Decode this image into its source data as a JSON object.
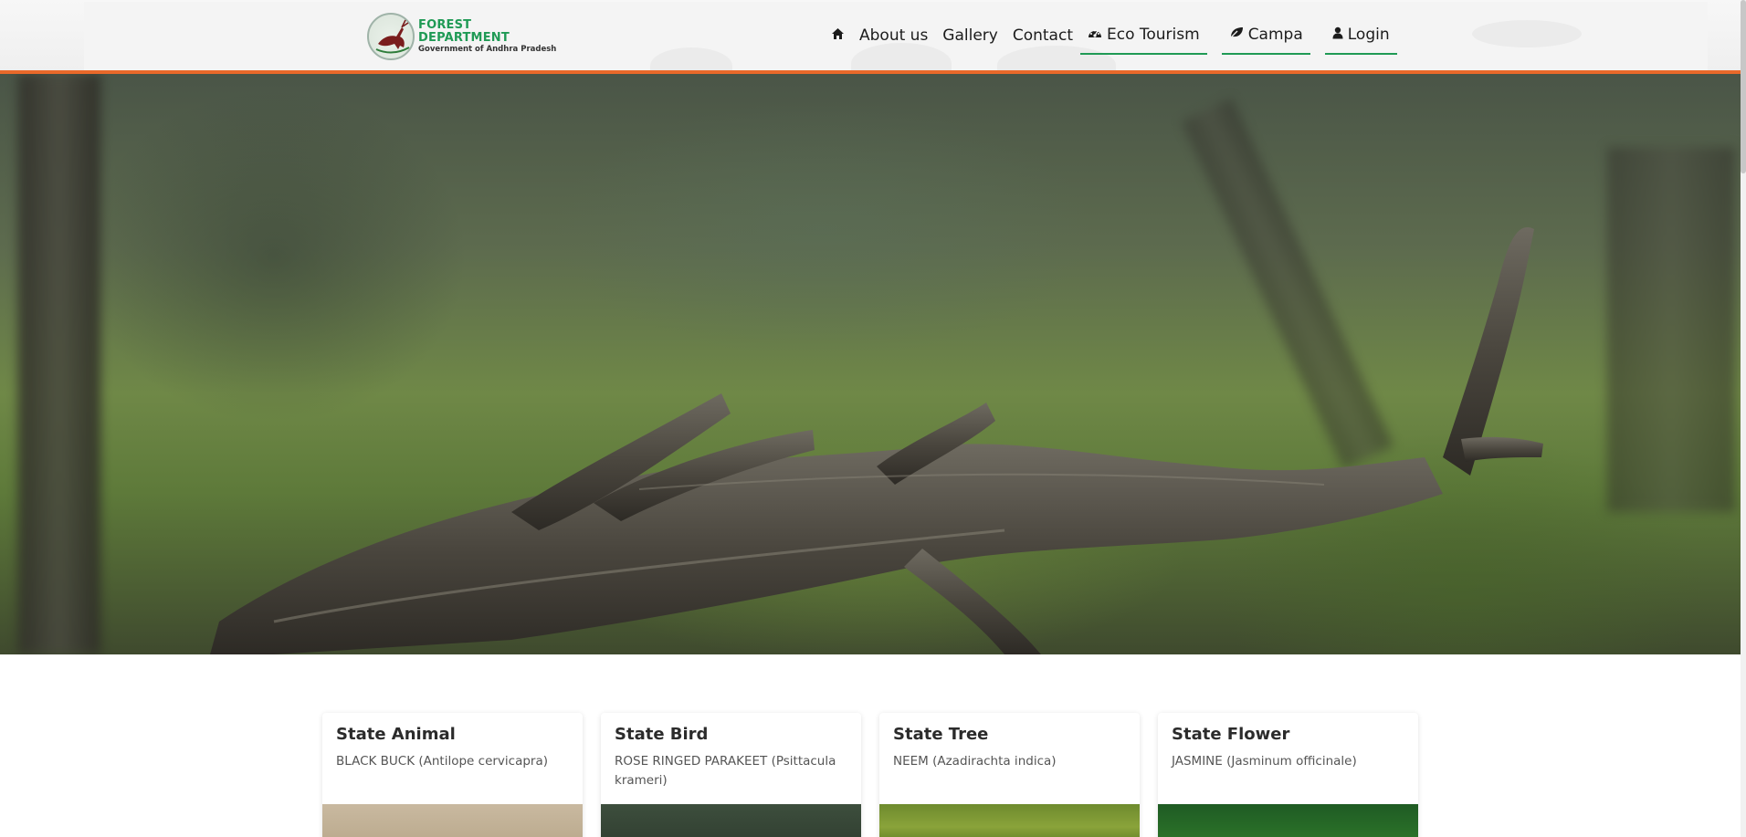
{
  "header": {
    "logo": {
      "title": "FOREST DEPARTMENT",
      "subtitle": "Government of Andhra Pradesh",
      "emblem_icon": "deer-emblem-icon"
    },
    "nav": [
      {
        "id": "home",
        "label": "",
        "icon": "home-icon"
      },
      {
        "id": "about",
        "label": "About us",
        "icon": ""
      },
      {
        "id": "gallery",
        "label": "Gallery",
        "icon": ""
      },
      {
        "id": "contact",
        "label": "Contact",
        "icon": ""
      },
      {
        "id": "eco",
        "label": "Eco Tourism",
        "icon": "dashboard-icon"
      },
      {
        "id": "campa",
        "label": "Campa",
        "icon": "leaf-icon"
      },
      {
        "id": "login",
        "label": "Login",
        "icon": "user-icon"
      }
    ]
  },
  "hero": {
    "image": "fallen-branch-forest-photo"
  },
  "cards": [
    {
      "title": "State Animal",
      "desc": "BLACK BUCK (Antilope cervicapra)",
      "image": "black-buck-photo"
    },
    {
      "title": "State Bird",
      "desc": "ROSE RINGED PARAKEET (Psittacula krameri)",
      "image": "parakeet-photo"
    },
    {
      "title": "State Tree",
      "desc": "NEEM (Azadirachta indica)",
      "image": "neem-tree-photo"
    },
    {
      "title": "State Flower",
      "desc": "JASMINE (Jasminum officinale)",
      "image": "jasmine-photo"
    }
  ],
  "colors": {
    "accent_orange": "#e8692a",
    "brand_green": "#1f9a55"
  }
}
